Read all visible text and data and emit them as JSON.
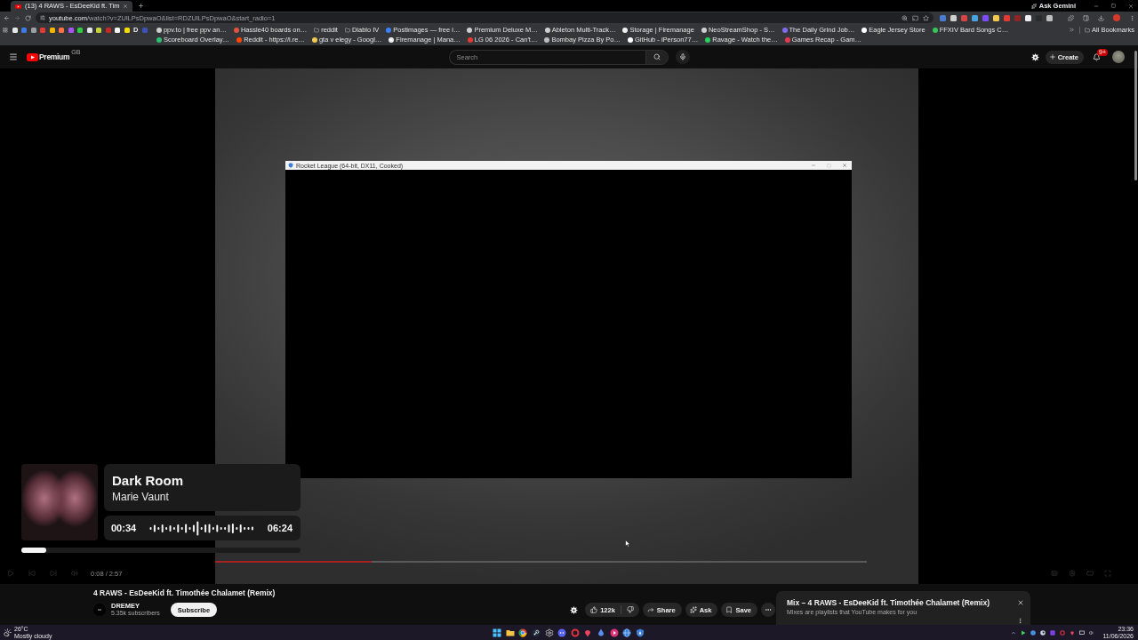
{
  "browser": {
    "tabs": [
      {
        "title": "(13) 4 RAWS - EsDeeKid ft. Tim",
        "selected": true
      }
    ],
    "ask_button": "Ask Gemini",
    "address": {
      "domain": "youtube.com",
      "path": "/watch?v=ZUlLPsDpwaO&list=RDZUlLPsDpwaO&start_radio=1"
    },
    "extensions": [
      {
        "color": "#4a7bd0"
      },
      {
        "color": "#cfcfcf"
      },
      {
        "color": "#d84343"
      },
      {
        "color": "#4aa3df"
      },
      {
        "color": "#7c4dff"
      },
      {
        "color": "#f2c94c"
      },
      {
        "color": "#e53935"
      },
      {
        "color": "#8e2424"
      },
      {
        "color": "#eeeeee"
      },
      {
        "color": "#2b2b2b"
      },
      {
        "color": "#bdbdbd"
      }
    ],
    "icon_bookmarks": [
      {
        "kind": "apps"
      },
      {
        "kind": "favicon",
        "color": "#e8e8e8"
      },
      {
        "kind": "favicon",
        "color": "#3d7be0"
      },
      {
        "kind": "favicon",
        "color": "#9aa0a6"
      },
      {
        "kind": "favicon",
        "color": "#e53935"
      },
      {
        "kind": "favicon",
        "color": "#f4b400"
      },
      {
        "kind": "favicon",
        "color": "#ff7043"
      },
      {
        "kind": "favicon",
        "color": "#a855f7"
      },
      {
        "kind": "favicon",
        "color": "#2ecc40"
      },
      {
        "kind": "favicon",
        "color": "#e5e5e5"
      },
      {
        "kind": "favicon",
        "color": "#c6d23a"
      },
      {
        "kind": "favicon",
        "color": "#c62828"
      },
      {
        "kind": "favicon",
        "color": "#f5f5f5"
      },
      {
        "kind": "favicon",
        "color": "#f5d90a"
      },
      {
        "kind": "letter",
        "label": "D"
      },
      {
        "kind": "favicon",
        "color": "#3f51b5"
      }
    ],
    "bookmarks": [
      {
        "kind": "site",
        "label": "ppv.to | free ppv an…",
        "color": "#cfcfcf"
      },
      {
        "kind": "site",
        "label": "Hassle40 boards on…",
        "color": "#e0533d"
      },
      {
        "kind": "folder",
        "label": "reddit"
      },
      {
        "kind": "folder",
        "label": "Diablo IV"
      },
      {
        "kind": "site",
        "label": "Postimages — free i…",
        "color": "#3b82f6"
      },
      {
        "kind": "site",
        "label": "Premium Deluxe M…",
        "color": "#d0d0d0"
      },
      {
        "kind": "site",
        "label": "Ableton Multi-Track…",
        "color": "#d0d0d0"
      },
      {
        "kind": "site",
        "label": "Storage | Firemanage",
        "color": "#f0f0f0"
      },
      {
        "kind": "site",
        "label": "NeoStreamShop - S…",
        "color": "#d0d0d0"
      },
      {
        "kind": "site",
        "label": "The Daily Grind Job…",
        "color": "#7c6cf0"
      },
      {
        "kind": "site",
        "label": "Eagle Jersey Store",
        "color": "#ffffff"
      },
      {
        "kind": "site",
        "label": "FFXIV Bard Songs C…",
        "color": "#34c759"
      },
      {
        "kind": "site",
        "label": "Scoreboard Overlay…",
        "color": "#2fbf71"
      },
      {
        "kind": "site",
        "label": "Reddit - https://i.re…",
        "color": "#ff4500"
      },
      {
        "kind": "site",
        "label": "gta v elegy - Googl…",
        "color": "#f2c94c"
      },
      {
        "kind": "site",
        "label": "Firemanage | Mana…",
        "color": "#f0f0f0"
      },
      {
        "kind": "site",
        "label": "LG 06 2026 - Can't…",
        "color": "#e53935"
      },
      {
        "kind": "site",
        "label": "Bombay Pizza By Po…",
        "color": "#bdbdbd"
      },
      {
        "kind": "site",
        "label": "GitHub - iPerson77…",
        "color": "#ffffff"
      },
      {
        "kind": "site",
        "label": "Ravage - Watch the…",
        "color": "#27d15f"
      },
      {
        "kind": "site",
        "label": "Games Recap - Gam…",
        "color": "#e53950"
      }
    ],
    "all_bookmarks": "All Bookmarks"
  },
  "header": {
    "logo": "Premium",
    "region": "GB",
    "search": {
      "placeholder": "Search"
    },
    "create_button": "Create",
    "notification_count": "9+"
  },
  "game_window": {
    "title": "Rocket League (64-bit, DX11, Cooked)"
  },
  "player": {
    "progress": {
      "level": 0.24
    },
    "time": "0:08 / 2:57"
  },
  "now_playing": {
    "title": "Dark Room",
    "artist": "Marie Vaunt",
    "elapsed": "00:34",
    "duration": "06:24",
    "progress": {
      "level": 0.09
    }
  },
  "video": {
    "title": "4 RAWS - EsDeeKid ft. Timothée Chalamet (Remix)",
    "channel": "DREMEY",
    "subscribers": "5.35k subscribers",
    "subscribe_button": "Subscribe",
    "likes": "122k",
    "actions": [
      {
        "kind": "share",
        "label": "Share"
      },
      {
        "kind": "ask",
        "label": "Ask"
      },
      {
        "kind": "save",
        "label": "Save"
      }
    ]
  },
  "mix_panel": {
    "title": "Mix – 4 RAWS - EsDeeKid ft. Timothée Chalamet (Remix)",
    "subtitle": "Mixes are playlists that YouTube makes for you"
  },
  "taskbar": {
    "weather": {
      "temperature": "26°C",
      "condition": "Mostly cloudy"
    },
    "clock": {
      "time": "23:36",
      "date": "11/06/2026"
    }
  }
}
